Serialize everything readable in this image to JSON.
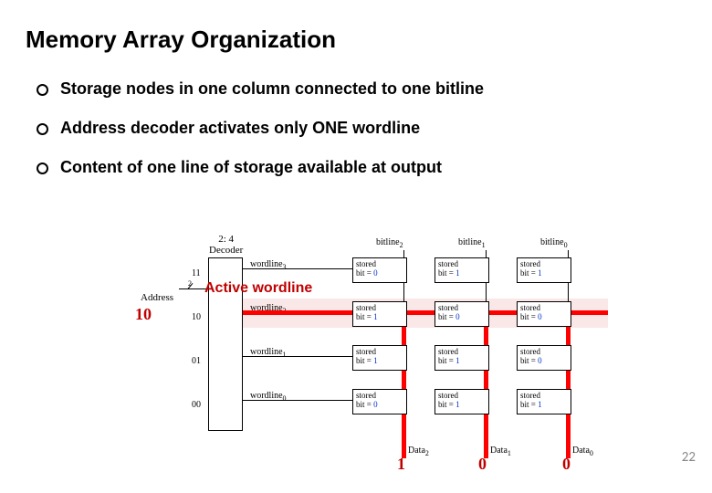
{
  "title": "Memory Array Organization",
  "bullets": [
    "Storage nodes in one column connected to one bitline",
    "Address decoder activates only ONE wordline",
    "Content of one line of storage available at output"
  ],
  "decoder": {
    "label_line1": "2: 4",
    "label_line2": "Decoder",
    "input_codes": [
      "11",
      "10",
      "01",
      "00"
    ]
  },
  "address": {
    "label": "Address",
    "width": "2",
    "value": "10"
  },
  "active_wordline_label": "Active wordline",
  "wordlines": [
    "wordline",
    "wordline",
    "wordline",
    "wordline"
  ],
  "wordline_subs": [
    "3",
    "2",
    "1",
    "0"
  ],
  "bitlines": [
    "bitline",
    "bitline",
    "bitline"
  ],
  "bitline_subs": [
    "2",
    "1",
    "0"
  ],
  "cell_label": "stored",
  "cell_label2": "bit = ",
  "grid": [
    [
      "0",
      "1",
      "1"
    ],
    [
      "1",
      "0",
      "0"
    ],
    [
      "1",
      "1",
      "0"
    ],
    [
      "0",
      "1",
      "1"
    ]
  ],
  "data_labels": [
    "Data",
    "Data",
    "Data"
  ],
  "data_subs": [
    "2",
    "1",
    "0"
  ],
  "data_values": [
    "1",
    "0",
    "0"
  ],
  "page_number": "22"
}
